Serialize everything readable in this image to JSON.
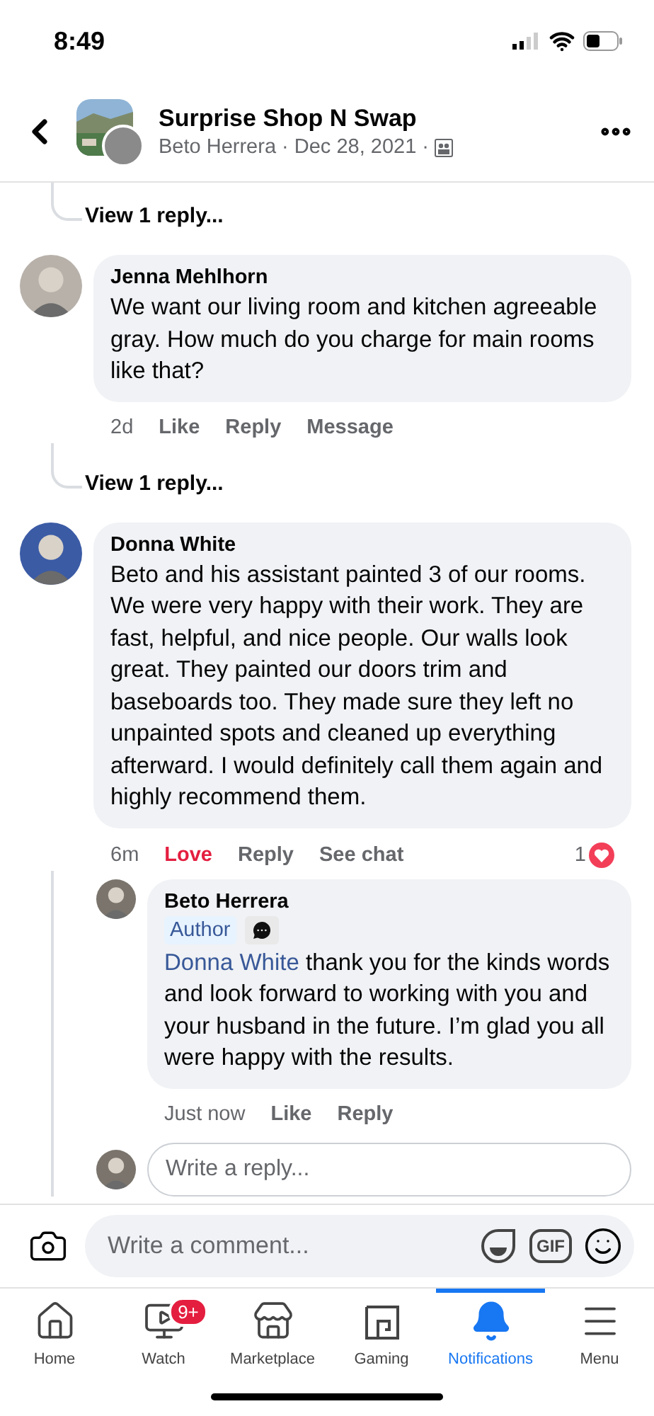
{
  "status_bar": {
    "time": "8:49"
  },
  "header": {
    "title": "Surprise Shop N Swap",
    "byline": "Beto Herrera · Dec 28, 2021 ·"
  },
  "thread": [
    {
      "kind": "view_replies",
      "label": "View 1 reply..."
    },
    {
      "kind": "comment",
      "author": "Jenna Mehlhorn",
      "text": "We want our living room and kitchen agreeable gray. How much do you charge for main rooms like that?",
      "actions": [
        {
          "label": "2d",
          "kind": "time",
          "active": false
        },
        {
          "label": "Like",
          "kind": "action",
          "active": false
        },
        {
          "label": "Reply",
          "kind": "action",
          "active": false
        },
        {
          "label": "Message",
          "kind": "action",
          "active": false
        }
      ]
    },
    {
      "kind": "view_replies",
      "label": "View 1 reply..."
    },
    {
      "kind": "comment",
      "author": "Donna White",
      "text": "Beto and his assistant painted 3 of our rooms. We were very happy with their work. They are fast, helpful, and nice people. Our walls look great. They painted our doors trim and baseboards too. They made sure they left no unpainted spots and cleaned up everything afterward. I would definitely call them again and highly recommend them.",
      "actions": [
        {
          "label": "6m",
          "kind": "time",
          "active": false
        },
        {
          "label": "Love",
          "kind": "action",
          "active": true
        },
        {
          "label": "Reply",
          "kind": "action",
          "active": false
        },
        {
          "label": "See chat",
          "kind": "action",
          "active": false
        }
      ],
      "reaction_count": "1",
      "replies": [
        {
          "kind": "comment",
          "author": "Beto Herrera",
          "badge": "Author",
          "mention": "Donna White",
          "text": "thank you for the kinds words and look forward to working with you and your husband in the future. I’m glad you all were happy with the results.",
          "actions": [
            {
              "label": "Just now",
              "kind": "time",
              "active": false
            },
            {
              "label": "Like",
              "kind": "action",
              "active": false
            },
            {
              "label": "Reply",
              "kind": "action",
              "active": false
            }
          ]
        },
        {
          "kind": "reply_input",
          "placeholder": "Write a reply..."
        }
      ]
    }
  ],
  "composer": {
    "placeholder": "Write a comment...",
    "gif_label": "GIF"
  },
  "tabs": [
    {
      "label": "Home",
      "selected": false
    },
    {
      "label": "Watch",
      "selected": false,
      "badge": "9+"
    },
    {
      "label": "Marketplace",
      "selected": false
    },
    {
      "label": "Gaming",
      "selected": false
    },
    {
      "label": "Notifications",
      "selected": true
    },
    {
      "label": "Menu",
      "selected": false
    }
  ]
}
